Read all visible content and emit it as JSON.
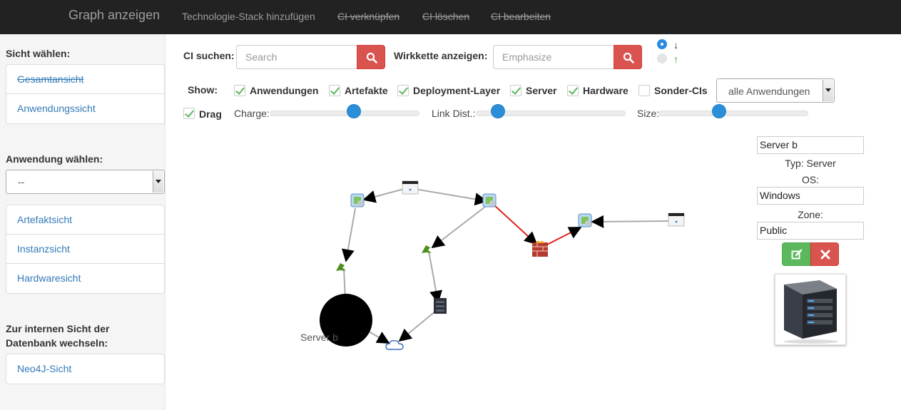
{
  "navbar": {
    "brand": "Graph anzeigen",
    "links": [
      {
        "label": "Technologie-Stack hinzufügen",
        "strike": false
      },
      {
        "label": "CI verknüpfen",
        "strike": true
      },
      {
        "label": "CI löschen",
        "strike": true
      },
      {
        "label": "CI bearbeiten",
        "strike": true
      }
    ]
  },
  "sidebar": {
    "view_heading": "Sicht wählen:",
    "views": [
      "Gesamtansicht",
      "Anwendungssicht"
    ],
    "app_heading": "Anwendung wählen:",
    "app_select_value": "--",
    "detail_views": [
      "Artefaktsicht",
      "Instanzsicht",
      "Hardwaresicht"
    ],
    "db_heading_line1": "Zur internen Sicht der",
    "db_heading_line2": "Datenbank wechseln:",
    "db_view": "Neo4J-Sicht"
  },
  "search": {
    "ci_label": "CI suchen:",
    "ci_placeholder": "Search",
    "chain_label": "Wirkkette anzeigen:",
    "chain_placeholder": "Emphasize",
    "dir_down": "↓",
    "dir_up": "↑",
    "dir_selected": "down"
  },
  "filters": {
    "show_label": "Show:",
    "items": [
      {
        "label": "Anwendungen",
        "checked": true
      },
      {
        "label": "Artefakte",
        "checked": true
      },
      {
        "label": "Deployment-Layer",
        "checked": true
      },
      {
        "label": "Server",
        "checked": true
      },
      {
        "label": "Hardware",
        "checked": true
      },
      {
        "label": "Sonder-CIs",
        "checked": false
      }
    ],
    "app_filter_value": "alle Anwendungen",
    "drag_label": "Drag",
    "drag_checked": true
  },
  "sliders": {
    "charge_label": "Charge:",
    "charge_level": 0.55,
    "link_label": "Link Dist.:",
    "link_level": 0.14,
    "size_label": "Size:",
    "size_level": 0.42
  },
  "graph": {
    "selected_node_label": "Server b",
    "highlight_color": "#e0231b",
    "edge_color": "#aaaaaa"
  },
  "details": {
    "name": "Server b",
    "type_text": "Typ: Server",
    "os_label": "OS:",
    "os_value": "Windows",
    "zone_label": "Zone:",
    "zone_value": "Public",
    "image_icon": "server-tower-icon"
  }
}
